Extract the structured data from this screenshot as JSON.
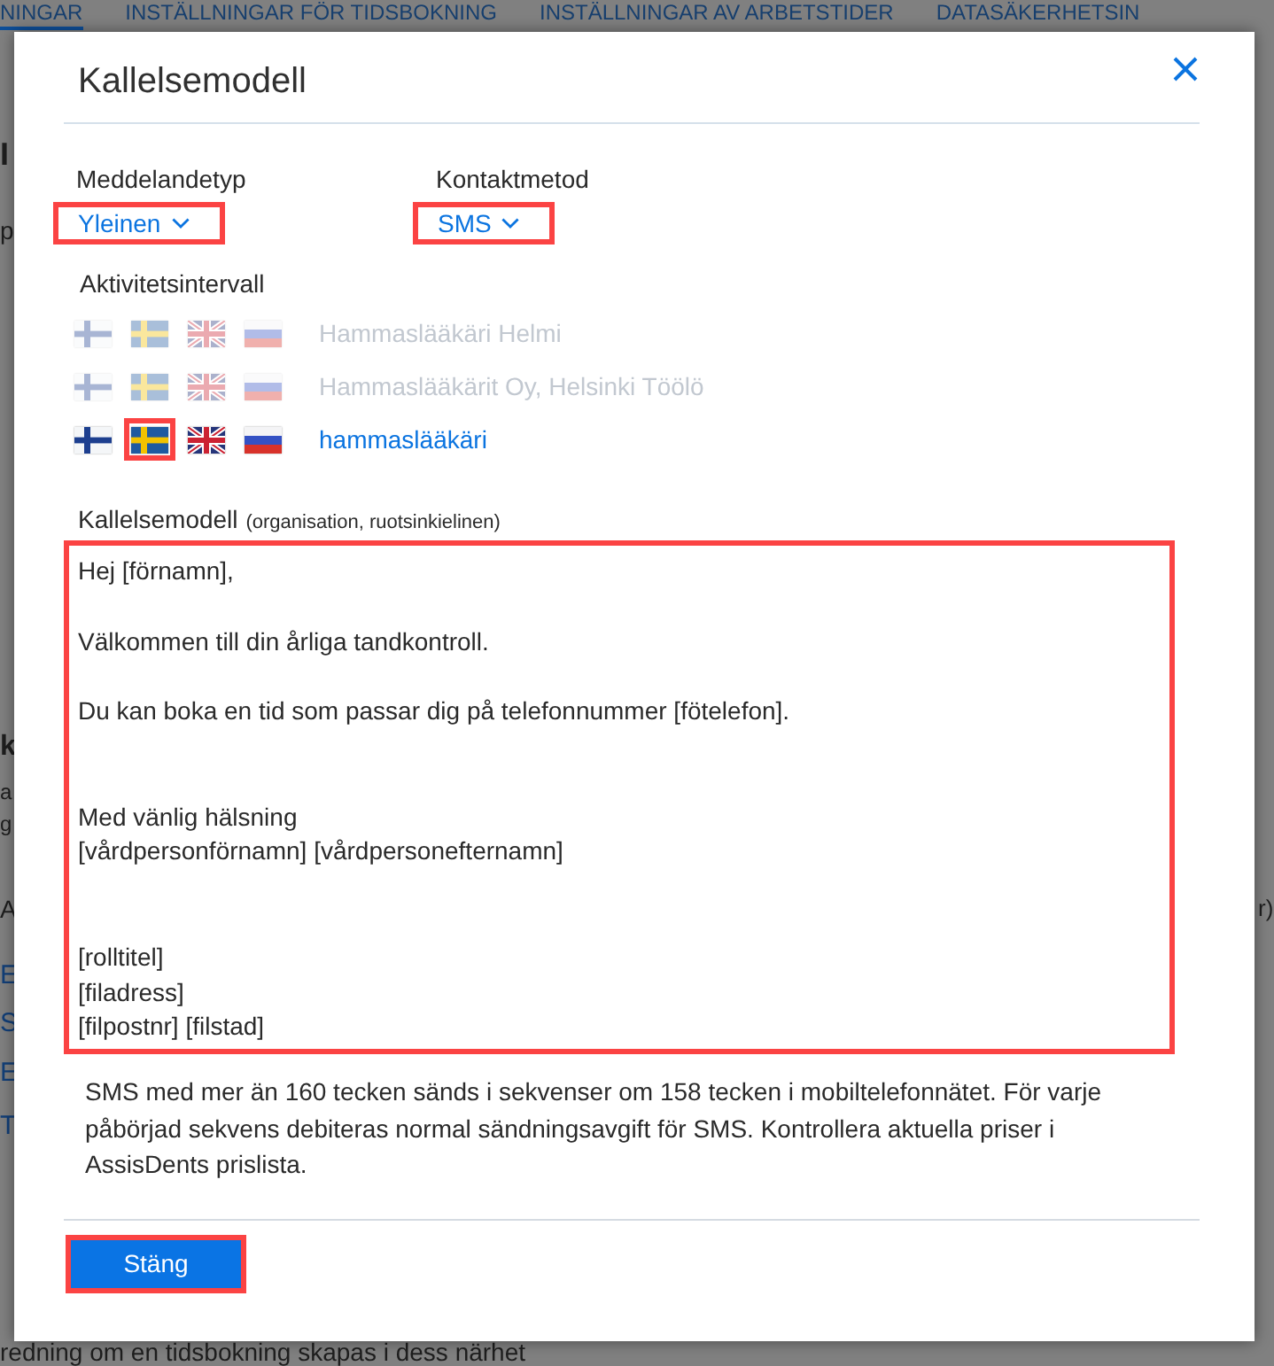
{
  "background": {
    "tabs": [
      {
        "label": "NINGAR",
        "selected": true
      },
      {
        "label": "INSTÄLLNINGAR FÖR TIDSBOKNING",
        "selected": false
      },
      {
        "label": "INSTÄLLNINGAR AV ARBETSTIDER",
        "selected": false
      },
      {
        "label": "DATASÄKERHETSIN",
        "selected": false
      }
    ],
    "left_fragments": [
      {
        "text": "I",
        "kind": "heading"
      },
      {
        "text": "p",
        "kind": "text"
      },
      {
        "text": "k",
        "kind": "heading"
      },
      {
        "text": "a",
        "kind": "text"
      },
      {
        "text": "g",
        "kind": "text"
      },
      {
        "text": "A",
        "kind": "text"
      },
      {
        "text": "E",
        "kind": "link"
      },
      {
        "text": "S",
        "kind": "link"
      },
      {
        "text": "E",
        "kind": "link"
      },
      {
        "text": "T",
        "kind": "link"
      }
    ],
    "right_fragment": "r)",
    "bottom_text": "redning om en tidsbokning skapas i dess närhet"
  },
  "dialog": {
    "title": "Kallelsemodell",
    "dropdowns": [
      {
        "label": "Meddelandetyp",
        "value": "Yleinen",
        "highlighted": true
      },
      {
        "label": "Kontaktmetod",
        "value": "SMS",
        "highlighted": true
      }
    ],
    "activity_label": "Aktivitetsintervall",
    "activity_rows": [
      {
        "name": "Hammaslääkäri Helmi",
        "disabled": true,
        "flags": [
          {
            "kind": "fi",
            "highlighted": false
          },
          {
            "kind": "se",
            "highlighted": false
          },
          {
            "kind": "gb",
            "highlighted": false
          },
          {
            "kind": "ru",
            "highlighted": false
          }
        ]
      },
      {
        "name": "Hammaslääkärit Oy, Helsinki Töölö",
        "disabled": true,
        "flags": [
          {
            "kind": "fi",
            "highlighted": false
          },
          {
            "kind": "se",
            "highlighted": false
          },
          {
            "kind": "gb",
            "highlighted": false
          },
          {
            "kind": "ru",
            "highlighted": false
          }
        ]
      },
      {
        "name": "hammaslääkäri",
        "disabled": false,
        "flags": [
          {
            "kind": "fi",
            "highlighted": false
          },
          {
            "kind": "se",
            "highlighted": true
          },
          {
            "kind": "gb",
            "highlighted": false
          },
          {
            "kind": "ru",
            "highlighted": false
          }
        ]
      }
    ],
    "template": {
      "label": "Kallelsemodell",
      "label_note": "(organisation, ruotsinkielinen)",
      "value": "Hej [förnamn],\n\nVälkommen till din årliga tandkontroll.\n\nDu kan boka en tid som passar dig på telefonnummer [fötelefon].\n\n\nMed vänlig hälsning\n[vårdpersonförnamn] [vårdpersonefternamn]\n\n\n[rolltitel]\n[filadress]\n[filpostnr] [filstad]",
      "highlighted": true
    },
    "note": "SMS med mer än 160 tecken sänds i sekvenser om 158 tecken i mobiltelefonnätet. För varje påbörjad sekvens debiteras normal sändningsavgift för SMS. Kontrollera aktuella priser i AssisDents prislista.",
    "close_button": {
      "label": "Stäng",
      "highlighted": true
    }
  }
}
